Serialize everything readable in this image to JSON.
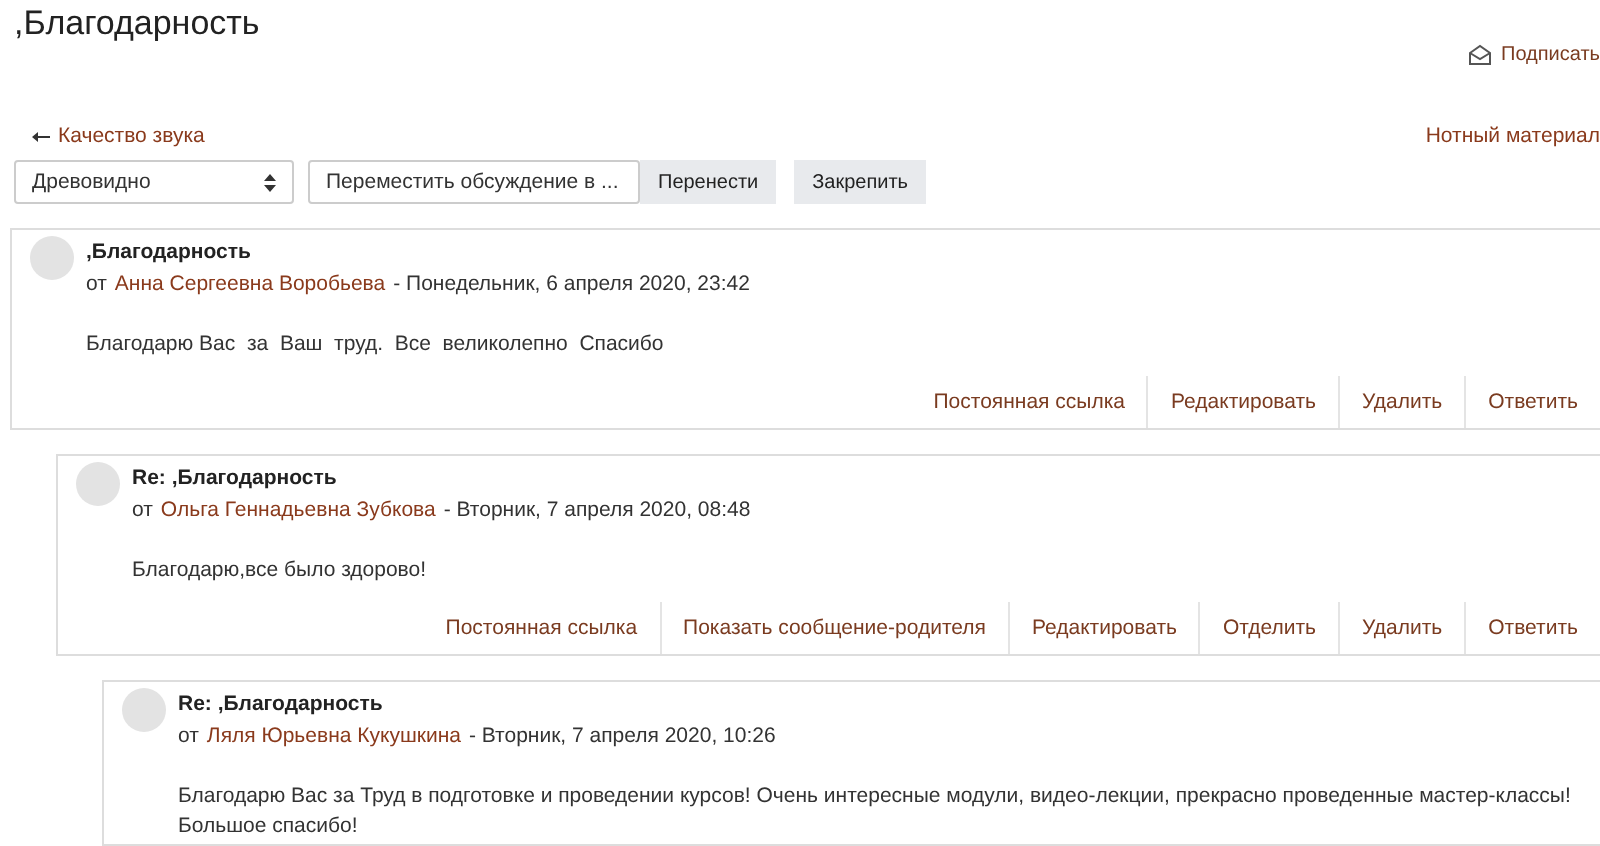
{
  "page_title": ",Благодарность",
  "subscribe_link": "Подписать",
  "prev_link": "Качество звука",
  "next_link": "Нотный материал",
  "display_mode_select": {
    "value": "Древовидно"
  },
  "move_select": {
    "value": "Переместить обсуждение в ..."
  },
  "buttons": [
    "Перенести",
    "Закрепить"
  ],
  "posts": [
    {
      "subject": ",Благодарность",
      "by": "от",
      "author": "Анна Сергеевна Воробьева",
      "date": "- Понедельник, 6 апреля 2020, 23:42",
      "message": "Благодарю Вас  за  Ваш  труд.  Все  великолепно  Спасибо",
      "actions": [
        "Постоянная ссылка",
        "Редактировать",
        "Удалить",
        "Ответить"
      ],
      "children": [
        {
          "subject": "Re: ,Благодарность",
          "by": "от",
          "author": "Ольга Геннадьевна Зубкова",
          "date": "- Вторник, 7 апреля 2020, 08:48",
          "message": "Благодарю,все было здорово!",
          "actions": [
            "Постоянная ссылка",
            "Показать сообщение-родителя",
            "Редактировать",
            "Отделить",
            "Удалить",
            "Ответить"
          ],
          "children": [
            {
              "subject": "Re: ,Благодарность",
              "by": "от",
              "author": "Ляля Юрьевна Кукушкина",
              "date": "- Вторник, 7 апреля 2020, 10:26",
              "message": "Благодарю Вас за Труд в подготовке и проведении курсов! Очень интересные модули, видео-лекции, прекрасно проведенные мастер-классы! Большое спасибо!"
            }
          ]
        }
      ]
    }
  ]
}
